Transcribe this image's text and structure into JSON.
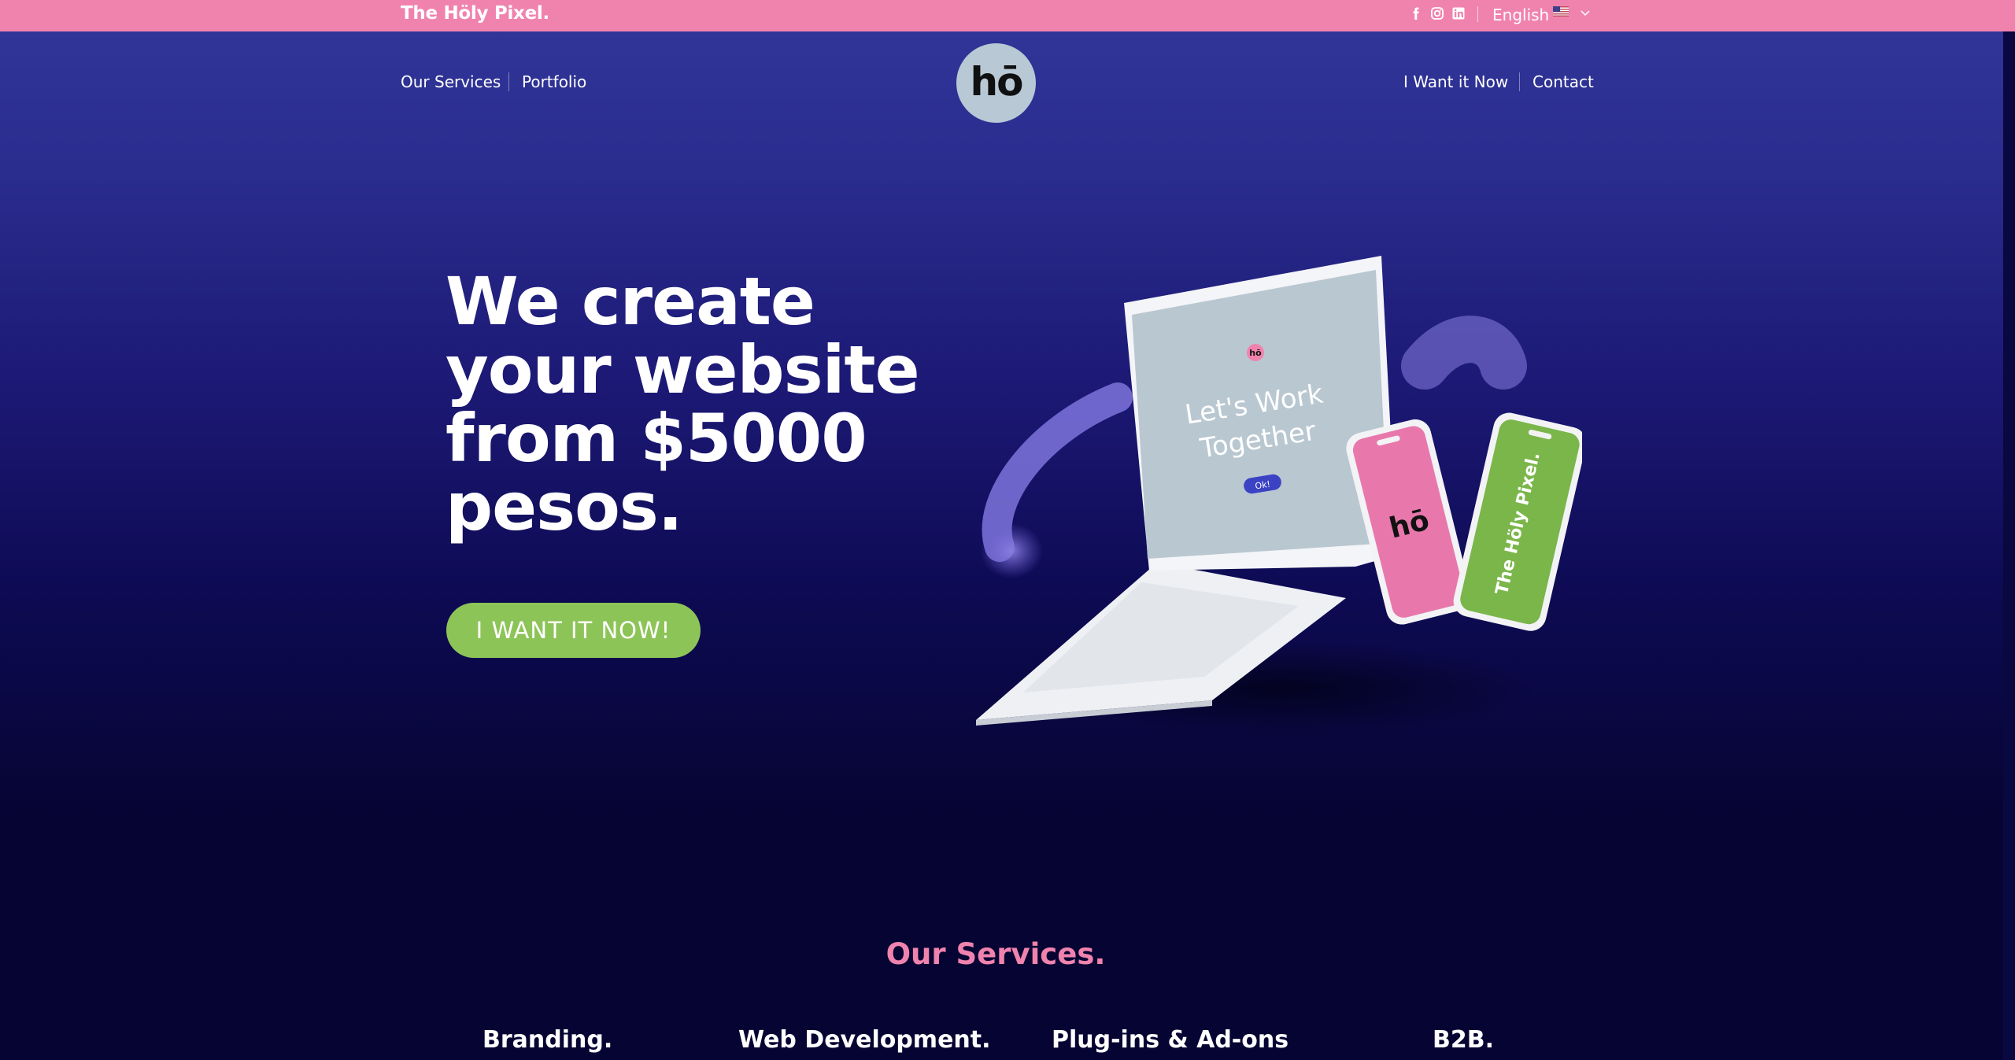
{
  "topbar": {
    "brand": "The Höly Pixel.",
    "language": "English",
    "social_icons": [
      "facebook-icon",
      "instagram-icon",
      "linkedin-icon"
    ]
  },
  "nav": {
    "left": [
      "Our Services",
      "Portfolio"
    ],
    "right": [
      "I Want it Now",
      "Contact"
    ],
    "logo_text": "hō"
  },
  "hero": {
    "headline_lines": [
      "We create",
      "your website",
      "from $5000",
      "pesos."
    ],
    "cta_label": "I WANT IT NOW!",
    "laptop_screen": {
      "heading_line1": "Let's Work",
      "heading_line2": "Together",
      "button": "Ok!",
      "badge": "hō"
    },
    "phone_pink_text": "hō",
    "phone_green_text": "The Höly Pixel."
  },
  "services": {
    "title": "Our Services.",
    "items": [
      "Branding.",
      "Web Development.",
      "Plug-ins & Ad-ons",
      "B2B."
    ]
  },
  "colors": {
    "pink": "#f083ae",
    "green": "#8dc458",
    "navy": "#060432",
    "indigo": "#303597"
  }
}
